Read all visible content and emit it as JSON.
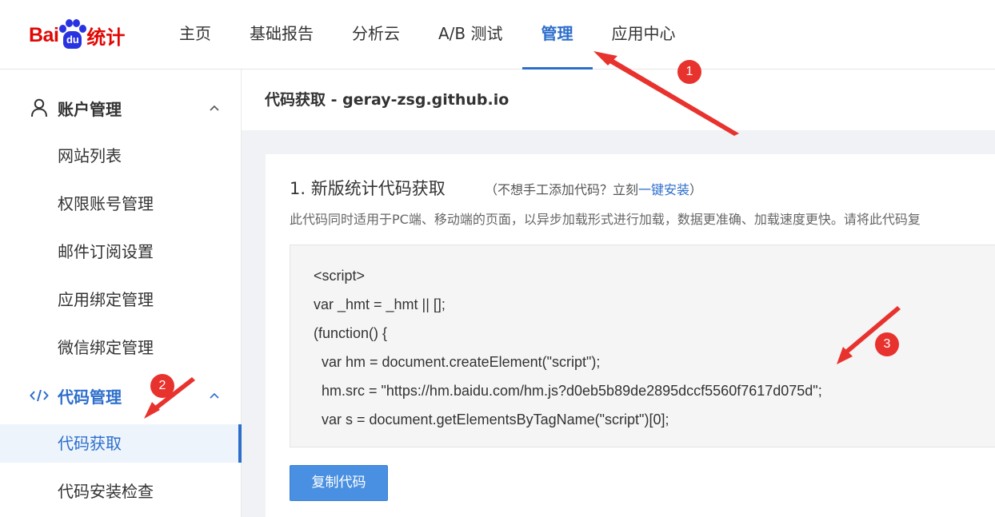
{
  "logo": {
    "bai": "Bai",
    "du": "du",
    "suffix": "统计"
  },
  "nav": {
    "items": [
      {
        "label": "主页",
        "active": false
      },
      {
        "label": "基础报告",
        "active": false
      },
      {
        "label": "分析云",
        "active": false
      },
      {
        "label": "A/B 测试",
        "active": false
      },
      {
        "label": "管理",
        "active": true
      },
      {
        "label": "应用中心",
        "active": false
      }
    ]
  },
  "sidebar": {
    "account_group": {
      "label": "账户管理",
      "items": [
        "网站列表",
        "权限账号管理",
        "邮件订阅设置",
        "应用绑定管理",
        "微信绑定管理"
      ]
    },
    "code_group": {
      "label": "代码管理",
      "items": [
        "代码获取",
        "代码安装检查"
      ],
      "active_item": "代码获取"
    }
  },
  "page": {
    "title": "代码获取 - geray-zsg.github.io"
  },
  "section": {
    "title": "1. 新版统计代码获取",
    "hint_prefix": "（不想手工添加代码？立刻",
    "hint_link": "一键安装",
    "hint_suffix": "）",
    "description": "此代码同时适用于PC端、移动端的页面，以异步加载形式进行加载，数据更准确、加载速度更快。请将此代码复"
  },
  "code": {
    "lines": [
      "<script>",
      "var _hmt = _hmt || [];",
      "(function() {",
      "  var hm = document.createElement(\"script\");",
      "  hm.src = \"https://hm.baidu.com/hm.js?d0eb5b89de2895dccf5560f7617d075d\";",
      "  var s = document.getElementsByTagName(\"script\")[0];"
    ]
  },
  "copy_button": {
    "label": "复制代码"
  },
  "annotations": {
    "badges": [
      "1",
      "2",
      "3"
    ],
    "color": "#e8322e"
  },
  "colors": {
    "accent": "#2d6ecb",
    "logo_red": "#e10602",
    "logo_blue": "#2932e1",
    "button": "#4a90e2"
  }
}
